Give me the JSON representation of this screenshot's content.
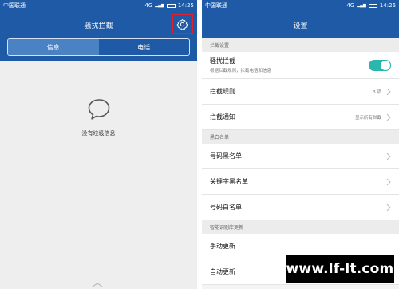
{
  "left": {
    "status": {
      "carrier": "中国联通",
      "network": "4G",
      "time": "14:25"
    },
    "title": "骚扰拦截",
    "tabs": [
      {
        "label": "信息",
        "active": true
      },
      {
        "label": "电话",
        "active": false
      }
    ],
    "empty_text": "没有垃圾信息",
    "icons": {
      "settings": "gear-icon",
      "empty": "message-bubble-icon"
    }
  },
  "right": {
    "status": {
      "carrier": "中国联通",
      "network": "4G",
      "time": "14:26"
    },
    "title": "设置",
    "sections": [
      {
        "header": "拦截设置",
        "items": [
          {
            "label": "骚扰拦截",
            "sub": "根据拦截规则，拦截电话和信息",
            "toggle": true
          },
          {
            "label": "拦截规则",
            "value": "3 项"
          },
          {
            "label": "拦截通知",
            "value": "显示所有拦截"
          }
        ]
      },
      {
        "header": "黑白名单",
        "items": [
          {
            "label": "号码黑名单"
          },
          {
            "label": "关键字黑名单"
          },
          {
            "label": "号码白名单"
          }
        ]
      },
      {
        "header": "智能识别库更新",
        "items": [
          {
            "label": "手动更新"
          },
          {
            "label": "自动更新",
            "toggle": true
          }
        ]
      }
    ]
  },
  "watermark": "www.lf-lt.com",
  "colors": {
    "primary": "#1e5aa6",
    "toggle_on": "#2bb6ae",
    "highlight_box": "#e0202a"
  }
}
